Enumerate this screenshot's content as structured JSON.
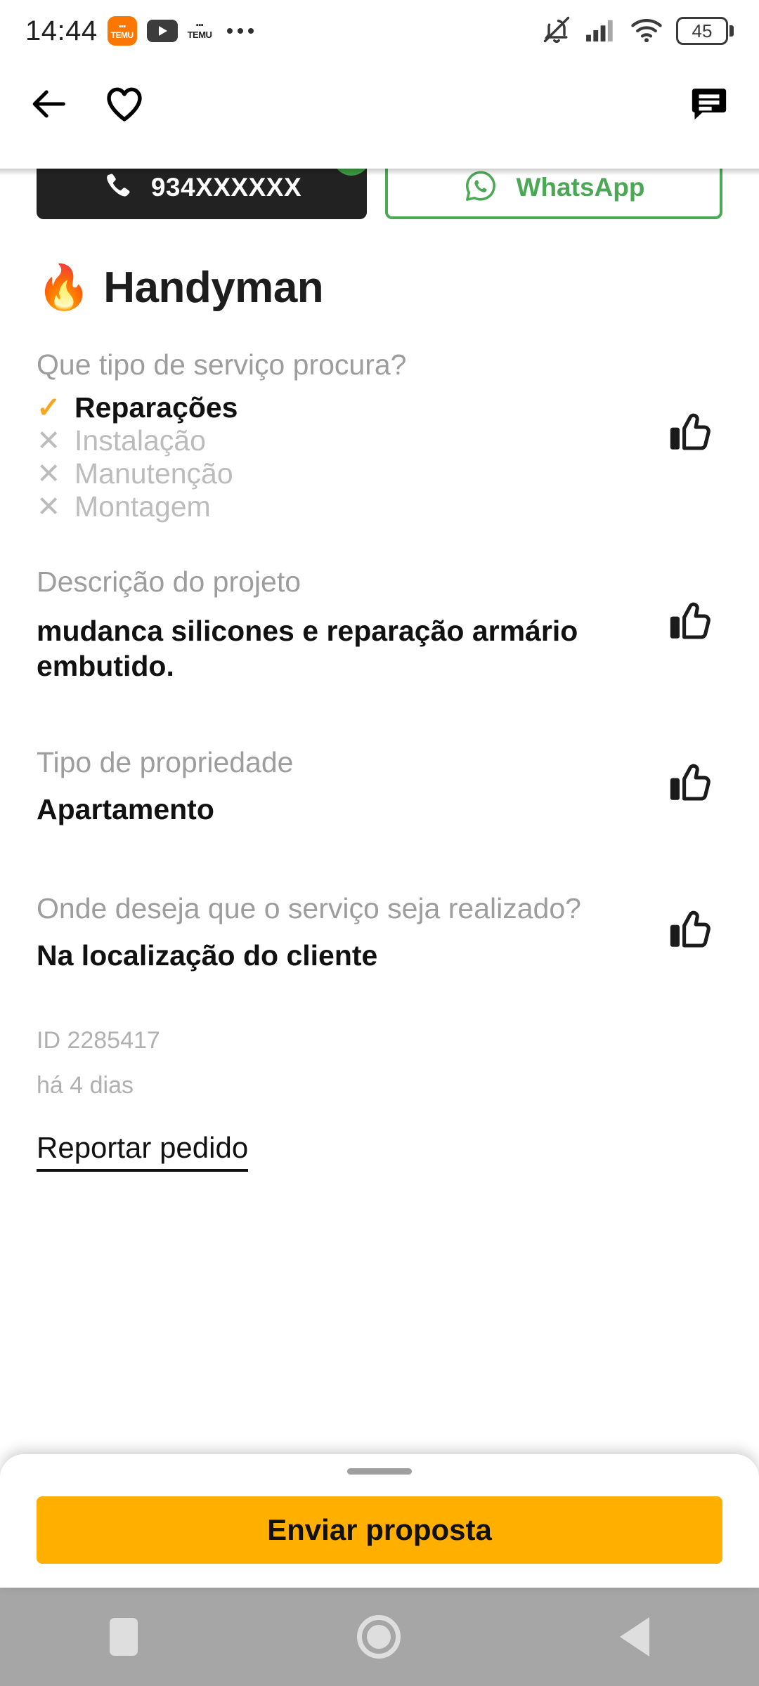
{
  "status_bar": {
    "time": "14:44",
    "icons": [
      "temu-app-icon",
      "youtube-icon",
      "temu-notification-icon",
      "more-dots-icon"
    ],
    "temu_label": "TEMU",
    "mute_icon": "bell-muted-icon",
    "signal_icon": "cellular-signal-icon",
    "wifi_icon": "wifi-icon",
    "battery_level": "45"
  },
  "app_bar": {
    "back_icon": "arrow-left-icon",
    "favorite_icon": "heart-outline-icon",
    "chat_icon": "chat-bubble-icon"
  },
  "contact": {
    "phone_number": "934XXXXXX",
    "phone_icon": "phone-icon",
    "verified_icon": "check-badge-icon",
    "whatsapp_label": "WhatsApp",
    "whatsapp_icon": "whatsapp-icon"
  },
  "listing": {
    "emoji": "🔥",
    "title": "Handyman",
    "service_type": {
      "label": "Que tipo de serviço procura?",
      "options": [
        {
          "text": "Reparações",
          "selected": true,
          "mark": "✓"
        },
        {
          "text": "Instalação",
          "selected": false,
          "mark": "✕"
        },
        {
          "text": "Manutenção",
          "selected": false,
          "mark": "✕"
        },
        {
          "text": "Montagem",
          "selected": false,
          "mark": "✕"
        }
      ]
    },
    "description": {
      "label": "Descrição do projeto",
      "value": "mudanca silicones e reparação armário embutido."
    },
    "property_type": {
      "label": "Tipo de propriedade",
      "value": "Apartamento"
    },
    "location": {
      "label": "Onde deseja que o serviço seja realizado?",
      "value": "Na localização do cliente"
    },
    "id": "ID 2285417",
    "posted": "há 4 dias",
    "report_link": "Reportar pedido",
    "thumb_icon": "thumbs-up-icon"
  },
  "bottom_sheet": {
    "submit_label": "Enviar proposta"
  },
  "nav_bar": {
    "recents_icon": "square-recents-icon",
    "home_icon": "circle-home-icon",
    "back_icon": "triangle-back-icon"
  },
  "colors": {
    "accent": "#FFAF00",
    "whatsapp_green": "#4BA956",
    "check_orange": "#F5A623",
    "muted_text": "#9d9d9d"
  }
}
